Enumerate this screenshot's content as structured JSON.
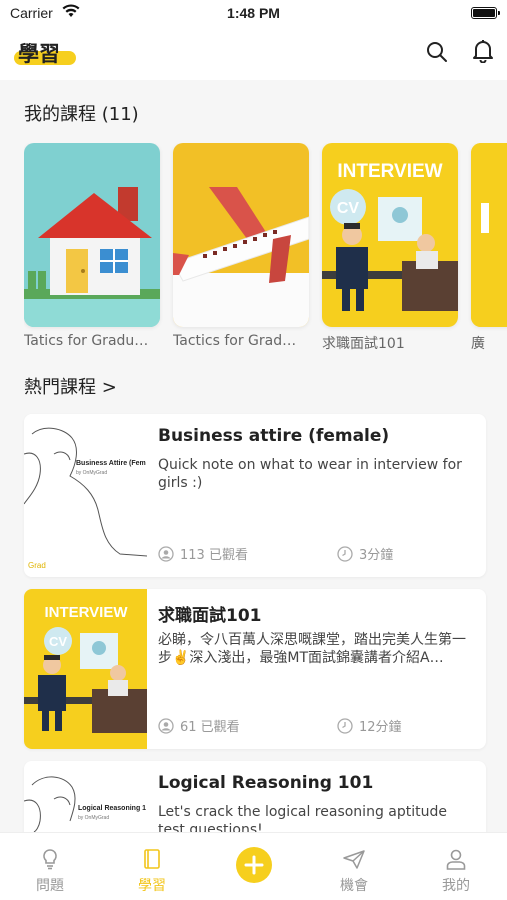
{
  "status_bar": {
    "carrier": "Carrier",
    "time": "1:48 PM"
  },
  "header": {
    "title": "學習"
  },
  "my_courses": {
    "title": "我的課程 (11)",
    "items": [
      {
        "label": "Tatics for Gradu…",
        "thumb": "house"
      },
      {
        "label": "Tactics for Grad…",
        "thumb": "airplane"
      },
      {
        "label": "求職面試101",
        "thumb": "interview"
      },
      {
        "label": "廣",
        "thumb": "partial"
      }
    ]
  },
  "popular_courses": {
    "title": "熱門課程 >",
    "cards": [
      {
        "title": "Business attire (female)",
        "description": "Quick note on what to wear in interview for girls :)",
        "views": "113 已觀看",
        "duration": "3分鐘",
        "thumb_text": "Business Attire (Fem",
        "thumb_sub": "by OnMyGrad"
      },
      {
        "title": "求職面試101",
        "description": "必睇，令八百萬人深思嘅課堂，踏出完美人生第一步✌️深入淺出，最強MT面試錦囊講者介紹A…",
        "views": "61 已觀看",
        "duration": "12分鐘",
        "thumb_text": "INTERVIEW",
        "thumb_sub": "CV"
      },
      {
        "title": "Logical Reasoning 101",
        "description": "Let's crack the logical reasoning aptitude test questions!",
        "thumb_text": "Logical Reasoning 1",
        "thumb_sub": "by OnMyGrad"
      }
    ]
  },
  "thumb_texts": {
    "interview_big": "INTERVIEW",
    "cv": "CV",
    "grad_logo": "Grad"
  },
  "tab_bar": {
    "items": [
      {
        "label": "問題",
        "icon": "lightbulb-icon"
      },
      {
        "label": "學習",
        "icon": "book-icon",
        "active": true
      },
      {
        "label": "",
        "icon": "add-icon"
      },
      {
        "label": "機會",
        "icon": "paper-plane-icon"
      },
      {
        "label": "我的",
        "icon": "person-icon"
      }
    ]
  },
  "colors": {
    "accent": "#f6cf1e",
    "teal": "#7fd0d0"
  }
}
